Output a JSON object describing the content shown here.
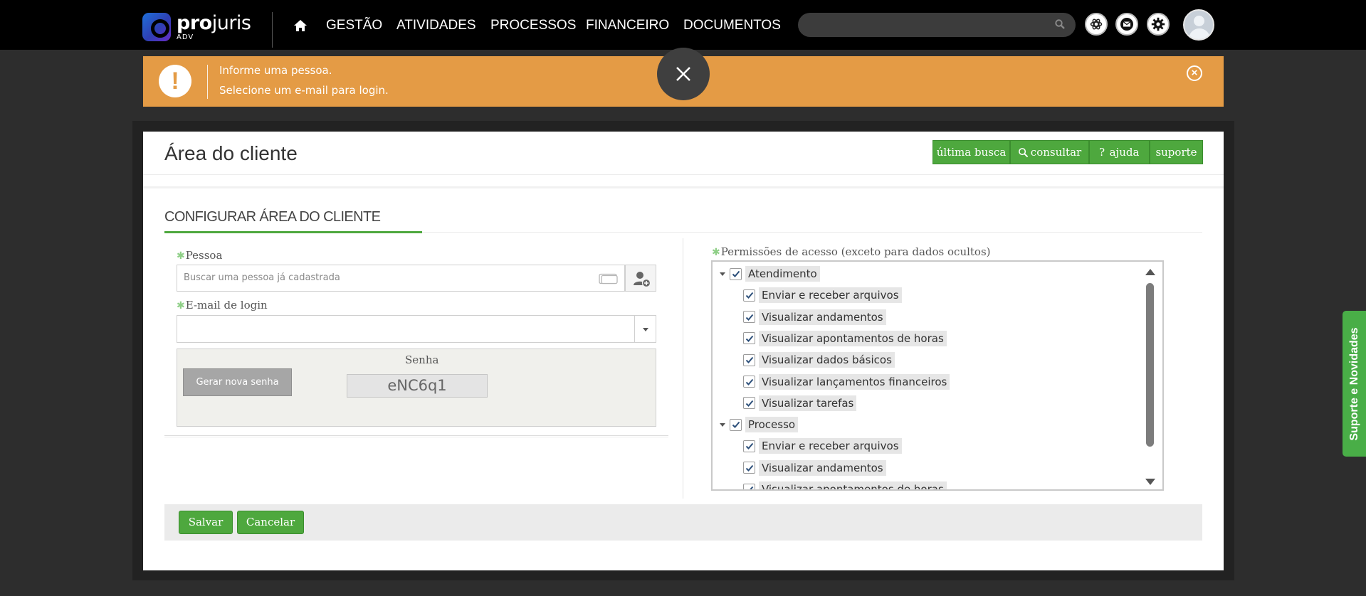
{
  "app": {
    "logo_name_bold": "pro",
    "logo_name_rest": "juris",
    "logo_sub": "ADV"
  },
  "nav": {
    "items": [
      "GESTÃO",
      "ATIVIDADES",
      "PROCESSOS",
      "FINANCEIRO",
      "DOCUMENTOS"
    ]
  },
  "search": {
    "placeholder": ""
  },
  "alert": {
    "messages": [
      "Informe uma pessoa.",
      "Selecione um e-mail para login."
    ],
    "color": "#e49b45"
  },
  "page": {
    "title": "Área do cliente",
    "toolbar": [
      "última busca",
      "consultar",
      "ajuda",
      "suporte"
    ],
    "section_title": "CONFIGURAR ÁREA DO CLIENTE"
  },
  "form": {
    "pessoa_label": "Pessoa",
    "pessoa_placeholder": "Buscar uma pessoa já cadastrada",
    "email_label": "E-mail de login",
    "email_value": "",
    "senha_label": "Senha",
    "gerar_button": "Gerar nova senha",
    "senha_value": "eNC6q1",
    "permissions_label": "Permissões de acesso (exceto para dados ocultos)"
  },
  "permissions": [
    {
      "group": "Atendimento",
      "checked": true,
      "items": [
        "Enviar e receber arquivos",
        "Visualizar andamentos",
        "Visualizar apontamentos de horas",
        "Visualizar dados básicos",
        "Visualizar lançamentos financeiros",
        "Visualizar tarefas"
      ]
    },
    {
      "group": "Processo",
      "checked": true,
      "items": [
        "Enviar e receber arquivos",
        "Visualizar andamentos",
        "Visualizar apontamentos de horas"
      ]
    }
  ],
  "footer": {
    "save": "Salvar",
    "cancel": "Cancelar"
  },
  "side_tab": "Suporte e Novidades",
  "colors": {
    "accent_green": "#4ea83e",
    "topbar": "#000000",
    "side_tab": "#49ae47"
  }
}
